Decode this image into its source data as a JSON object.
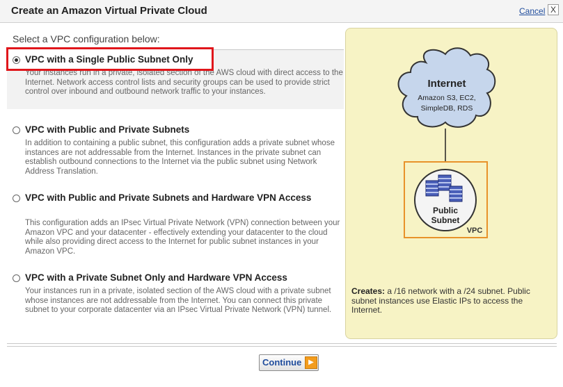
{
  "dialog": {
    "title": "Create an Amazon Virtual Private Cloud",
    "cancel_label": "Cancel",
    "close_glyph": "X"
  },
  "prompt": "Select a VPC configuration below:",
  "options": [
    {
      "title": "VPC with a Single Public Subnet Only",
      "desc": "Your instances run in a private, isolated section of the AWS cloud with direct access to the Internet. Network access control lists and security groups can be used to provide strict control over inbound and outbound network traffic to your instances.",
      "selected": true
    },
    {
      "title": "VPC with Public and Private Subnets",
      "desc": "In addition to containing a public subnet, this configuration adds a private subnet whose instances are not addressable from the Internet. Instances in the private subnet can establish outbound connections to the Internet via the public subnet using Network Address Translation.",
      "selected": false
    },
    {
      "title": "VPC with Public and Private Subnets and Hardware VPN Access",
      "desc": "This configuration adds an IPsec Virtual Private Network (VPN) connection between your Amazon VPC and your datacenter - effectively extending your datacenter to the cloud while also providing direct access to the Internet for public subnet instances in your Amazon VPC.",
      "selected": false
    },
    {
      "title": "VPC with a Private Subnet Only and Hardware VPN Access",
      "desc": "Your instances run in a private, isolated section of the AWS cloud with a private subnet whose instances are not addressable from the Internet. You can connect this private subnet to your corporate datacenter via an IPsec Virtual Private Network (VPN) tunnel.",
      "selected": false
    }
  ],
  "diagram": {
    "cloud_title": "Internet",
    "cloud_line1": "Amazon S3, EC2,",
    "cloud_line2": "SimpleDB, RDS",
    "subnet_line1": "Public",
    "subnet_line2": "Subnet",
    "vpc_label": "VPC",
    "icons": [
      "cloud-icon",
      "server-stack-icon"
    ],
    "colors": {
      "panel": "#f7f3c5",
      "cloud_fill": "#c6d6ec",
      "vpc_border": "#e8922a",
      "subnet_fill": "#f4f4f4"
    }
  },
  "summary": {
    "label": "Creates:",
    "text": " a /16 network with a /24 subnet. Public subnet instances use Elastic IPs to access the Internet."
  },
  "footer": {
    "continue_label": "Continue",
    "continue_icon": "arrow-right-icon"
  },
  "colors": {
    "highlight": "#e0161b",
    "link": "#1f4c9c",
    "continue_arrow": "#f39c1d"
  }
}
